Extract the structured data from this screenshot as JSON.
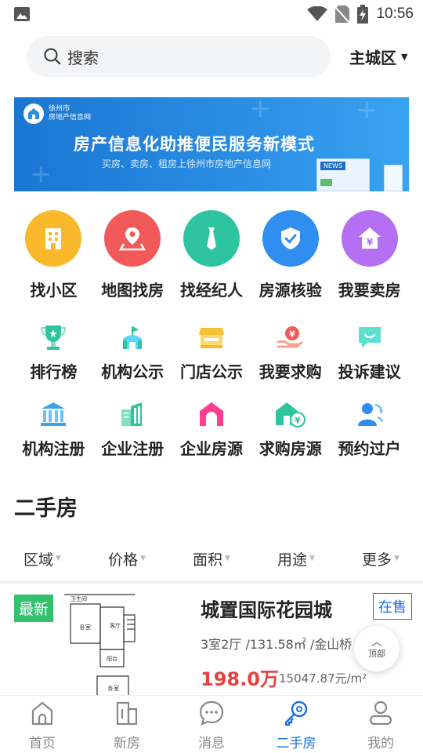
{
  "status_bar": {
    "time": "10:56"
  },
  "search": {
    "placeholder": "搜索",
    "city": "主城区"
  },
  "banner": {
    "logo_line1": "徐州市",
    "logo_line2": "房地产信息网",
    "headline": "房产信息化助推便民服务新模式",
    "subline": "买房、卖房、租房上徐州市房地产信息网",
    "news_tag": "NEWS"
  },
  "main_services": [
    {
      "label": "找小区",
      "icon": "building-icon",
      "color": "#f9b92b"
    },
    {
      "label": "地图找房",
      "icon": "map-pin-icon",
      "color": "#f25a5a"
    },
    {
      "label": "找经纪人",
      "icon": "tie-icon",
      "color": "#2ec4a0"
    },
    {
      "label": "房源核验",
      "icon": "shield-check-icon",
      "color": "#2f8ef0"
    },
    {
      "label": "我要卖房",
      "icon": "house-yen-icon",
      "color": "#b46ff2"
    }
  ],
  "services_row2": [
    {
      "label": "排行榜",
      "icon": "trophy-icon"
    },
    {
      "label": "机构公示",
      "icon": "institution-icon"
    },
    {
      "label": "门店公示",
      "icon": "store-icon"
    },
    {
      "label": "我要求购",
      "icon": "hand-yen-icon"
    },
    {
      "label": "投诉建议",
      "icon": "chat-icon"
    }
  ],
  "services_row3": [
    {
      "label": "机构注册",
      "icon": "bank-icon"
    },
    {
      "label": "企业注册",
      "icon": "office-building-icon"
    },
    {
      "label": "企业房源",
      "icon": "house-arch-icon"
    },
    {
      "label": "求购房源",
      "icon": "house-money-icon"
    },
    {
      "label": "预约过户",
      "icon": "person-swap-icon"
    }
  ],
  "section": {
    "title": "二手房"
  },
  "filters": [
    "区域",
    "价格",
    "面积",
    "用途",
    "更多"
  ],
  "listing": {
    "badge": "最新",
    "title": "城置国际花园城",
    "status": "在售",
    "meta": "3室2厅 /131.58㎡ /金山桥",
    "price": "198.0万",
    "unit_price": "15047.87元/m²",
    "floorplan_labels": [
      "卫生间",
      "卧室",
      "客厅",
      "阳台",
      "卧室"
    ]
  },
  "back_to_top": "顶部",
  "bottom_nav": [
    {
      "label": "首页",
      "icon": "home-icon",
      "active": false
    },
    {
      "label": "新房",
      "icon": "new-house-icon",
      "active": false
    },
    {
      "label": "消息",
      "icon": "message-icon",
      "active": false
    },
    {
      "label": "二手房",
      "icon": "key-icon",
      "active": true
    },
    {
      "label": "我的",
      "icon": "profile-icon",
      "active": false
    }
  ],
  "colors": {
    "accent": "#1d6fe0",
    "price": "#e64340",
    "new_badge": "#33c16e"
  }
}
